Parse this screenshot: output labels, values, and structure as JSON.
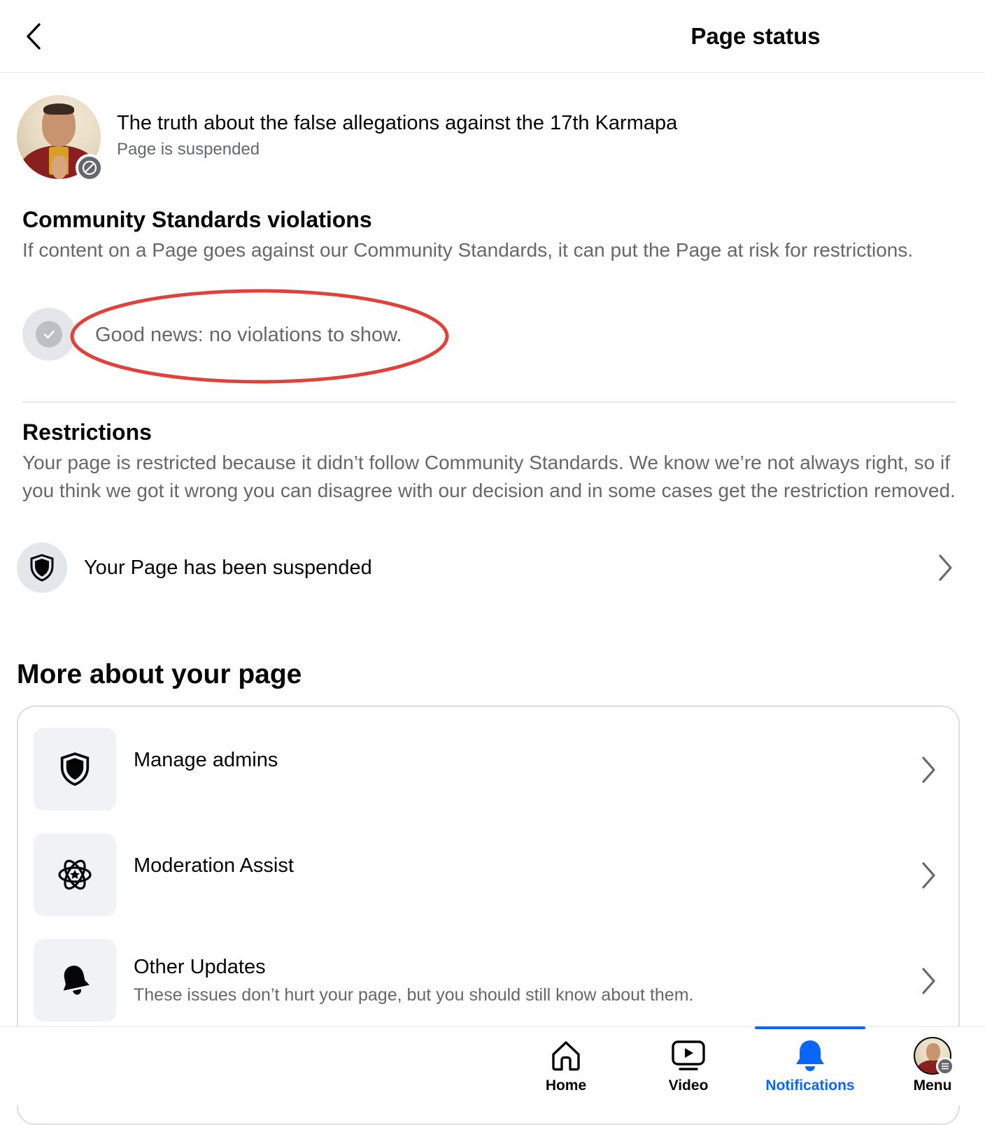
{
  "header": {
    "title": "Page status",
    "back_icon": "chevron-left-icon"
  },
  "page": {
    "name": "The truth about the false allegations against the 17th Karmapa",
    "status": "Page is suspended"
  },
  "community_standards": {
    "title": "Community Standards violations",
    "description": "If content on a Page goes against our Community Standards, it can put the Page at risk for restrictions.",
    "empty_message": "Good news: no violations to show.",
    "highlight_color": "#e0413a"
  },
  "restrictions": {
    "title": "Restrictions",
    "description": "Your page is restricted because it didn’t follow Community Standards. We know we’re not always right, so if you think we got it wrong you can disagree with our decision and in some cases get the restriction removed.",
    "item_label": "Your Page has been suspended",
    "item_icon": "shield-icon"
  },
  "more": {
    "title": "More about your page",
    "items": [
      {
        "label": "Manage admins",
        "icon": "shield-icon",
        "subtitle": ""
      },
      {
        "label": "Moderation Assist",
        "icon": "atom-star-icon",
        "subtitle": ""
      },
      {
        "label": "Other Updates",
        "icon": "bell-icon",
        "subtitle": "These issues don’t hurt your page, but you should still know about them."
      }
    ]
  },
  "bottom_nav": {
    "active": "Notifications",
    "active_color": "#0866ff",
    "items": [
      {
        "label": "Home",
        "icon": "home-icon"
      },
      {
        "label": "Video",
        "icon": "video-icon"
      },
      {
        "label": "Notifications",
        "icon": "bell-icon"
      },
      {
        "label": "Menu",
        "icon": "profile-avatar"
      }
    ]
  }
}
